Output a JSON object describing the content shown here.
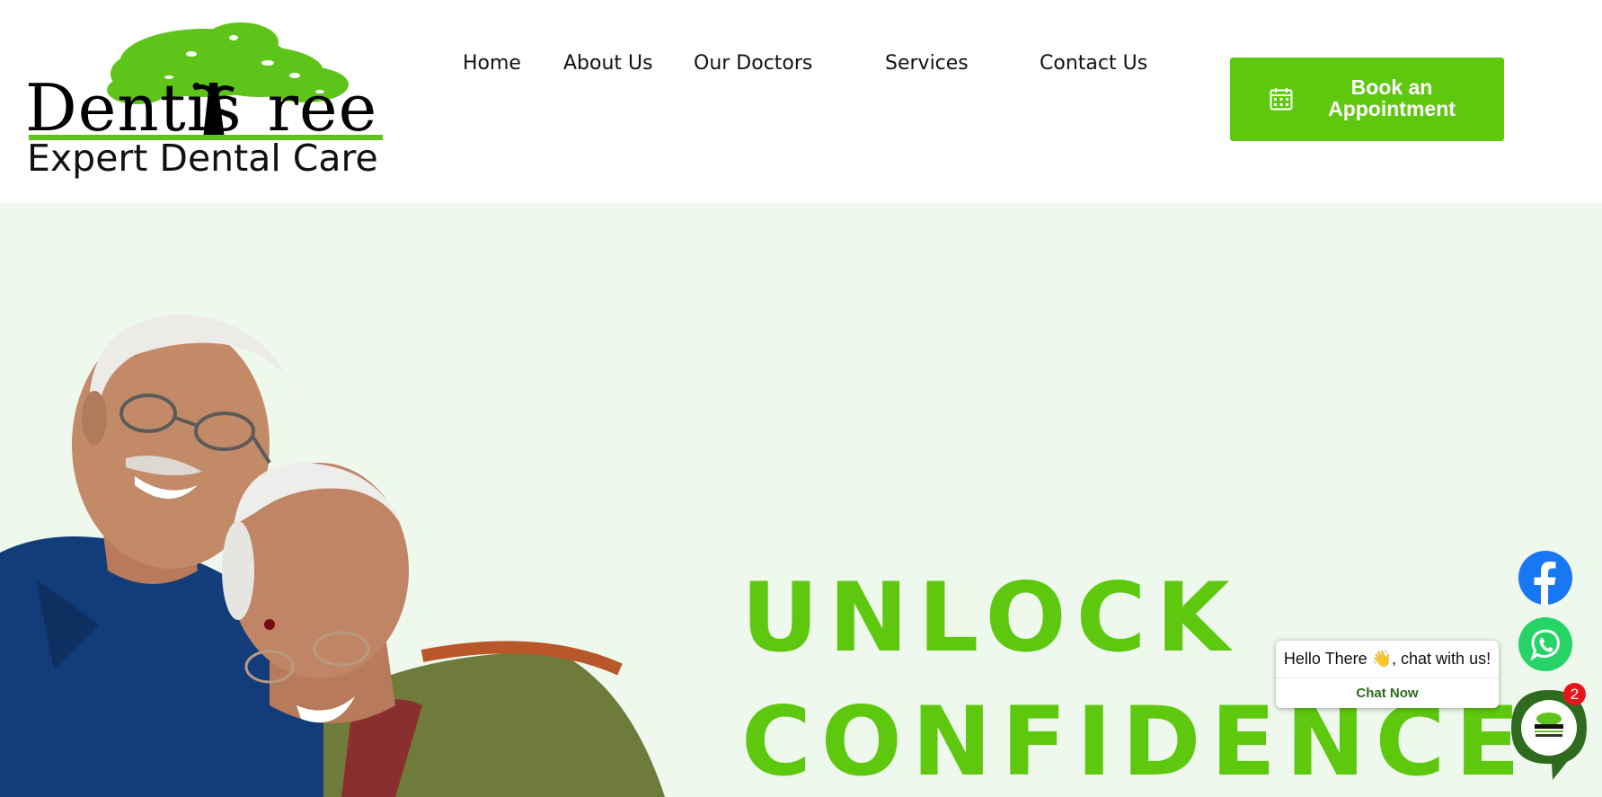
{
  "brand": {
    "name": "DentisTree",
    "tagline": "Expert Dental Care",
    "word_left": "Dentis",
    "word_right": "ree",
    "accent_color": "#5ec80f"
  },
  "nav": {
    "items": [
      {
        "label": "Home"
      },
      {
        "label": "About Us"
      },
      {
        "label": "Our Doctors"
      },
      {
        "label": "Services"
      },
      {
        "label": "Contact Us"
      }
    ]
  },
  "cta": {
    "book_line1": "Book an",
    "book_line2": "Appointment",
    "icon": "calendar-icon"
  },
  "hero": {
    "line1": "UNLOCK",
    "line2": "CONFIDENCE",
    "text_color": "#5ec80f",
    "background": "#eef8ec"
  },
  "floating": {
    "facebook_icon": "facebook-icon",
    "whatsapp_icon": "whatsapp-icon",
    "chat_greeting": "Hello There 👋, chat with us!",
    "chat_cta": "Chat Now",
    "unread_count": "2"
  }
}
